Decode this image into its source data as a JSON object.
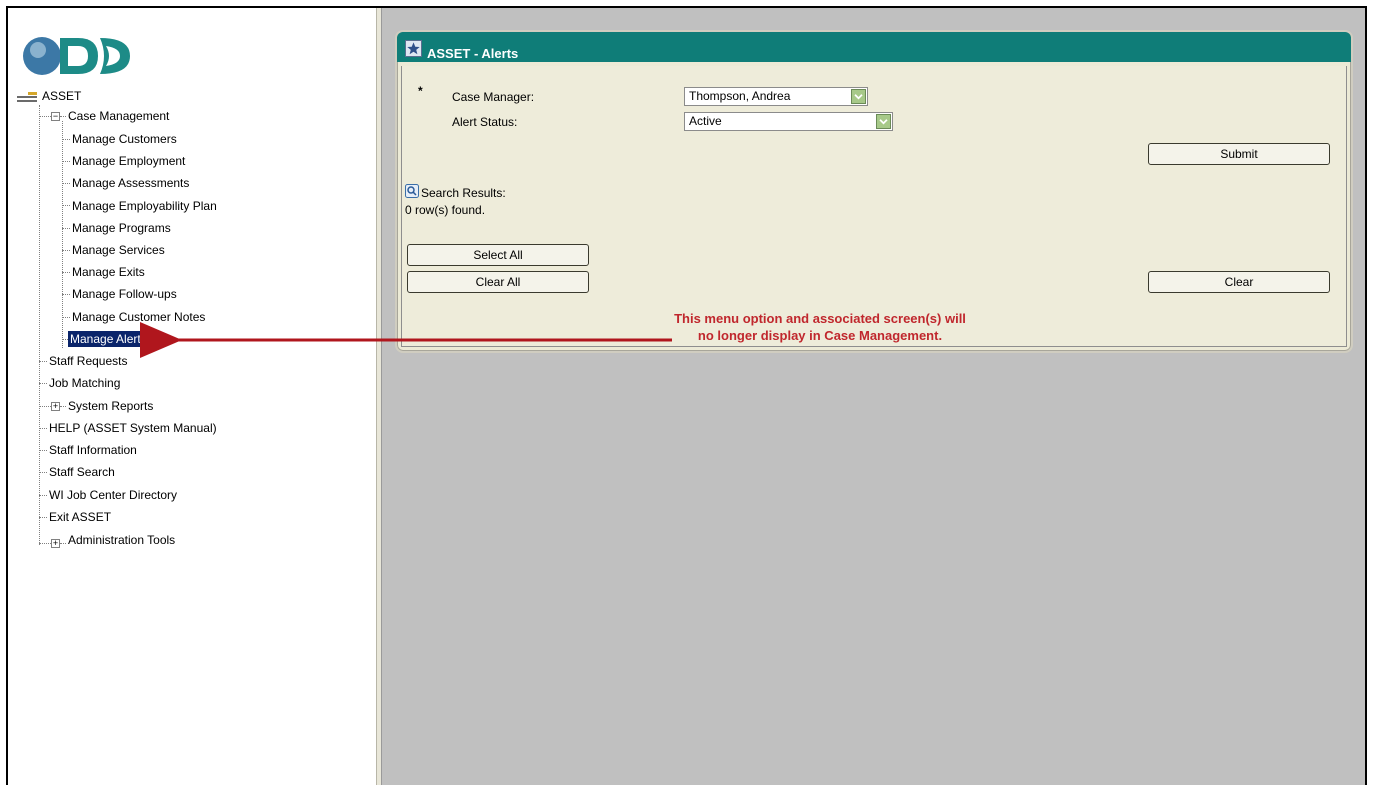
{
  "app": {
    "title": "ASSET"
  },
  "nav": {
    "root_label": "ASSET",
    "case_management": {
      "label": "Case Management",
      "expander": "−",
      "items": [
        {
          "label": "Manage Customers"
        },
        {
          "label": "Manage Employment"
        },
        {
          "label": "Manage Assessments"
        },
        {
          "label": "Manage Employability Plan"
        },
        {
          "label": "Manage Programs"
        },
        {
          "label": "Manage Services"
        },
        {
          "label": "Manage Exits"
        },
        {
          "label": "Manage Follow-ups"
        },
        {
          "label": "Manage Customer Notes"
        },
        {
          "label": "Manage Alerts",
          "selected": true
        }
      ]
    },
    "top_items": [
      {
        "label": "Staff Requests"
      },
      {
        "label": "Job Matching"
      },
      {
        "label": "System Reports",
        "expander": "+"
      },
      {
        "label": "HELP (ASSET System Manual)"
      },
      {
        "label": "Staff Information"
      },
      {
        "label": "Staff Search"
      },
      {
        "label": "WI Job Center Directory"
      },
      {
        "label": "Exit ASSET"
      },
      {
        "label": "Administration Tools",
        "expander": "+"
      }
    ]
  },
  "panel": {
    "title": "ASSET - Alerts",
    "required_marker": "*",
    "case_manager_label": "Case Manager:",
    "case_manager_value": "Thompson, Andrea",
    "alert_status_label": "Alert Status:",
    "alert_status_value": "Active",
    "submit_label": "Submit",
    "search_results_label": "Search Results:",
    "rows_found": "0 row(s) found.",
    "select_all_label": "Select All",
    "clear_all_label": "Clear All",
    "clear_label": "Clear"
  },
  "annotation": {
    "line1": "This menu option and associated screen(s) will",
    "line2": "no longer display in Case Management."
  },
  "colors": {
    "panel_header": "#0f7d78",
    "annotation": "#c0272d",
    "selected_bg": "#0a246a",
    "content_bg": "#c0c0c0"
  },
  "icons": {
    "logo": "dwd-logo",
    "root": "asset-root-icon",
    "panel": "star-icon",
    "search": "magnifier-icon",
    "dropdown": "chevron-down-icon"
  }
}
